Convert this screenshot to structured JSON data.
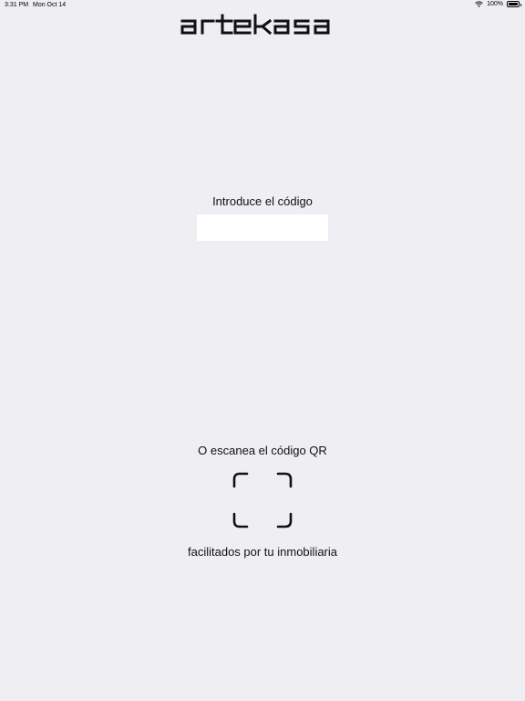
{
  "status_bar": {
    "time": "3:31 PM",
    "date": "Mon Oct 14",
    "battery": "100%",
    "battery_level": 1.0,
    "icons": [
      "wifi-icon",
      "battery-icon"
    ]
  },
  "brand": {
    "logo_text": "artekasa"
  },
  "code_entry": {
    "label": "Introduce el código",
    "value": "",
    "placeholder": ""
  },
  "qr_scan": {
    "label": "O escanea el código QR",
    "icon": "qr-scan-frame-icon",
    "sub_label": "facilitados por tu inmobiliaria"
  },
  "colors": {
    "background": "#efeef2",
    "input_background": "#ffffff",
    "text": "#111111"
  }
}
